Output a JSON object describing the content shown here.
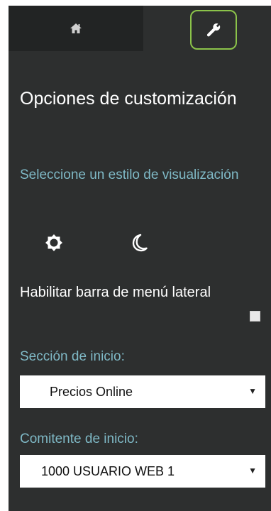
{
  "tabs": {
    "home_icon": "home-icon",
    "tools_icon": "wrench-icon",
    "active_border_color": "#8bc34a"
  },
  "panel": {
    "title": "Opciones de customización",
    "style_label": "Seleccione un estilo de visualización",
    "style_options": [
      "sun-icon",
      "moon-icon"
    ],
    "sidebar_label": "Habilitar barra de menú lateral",
    "sidebar_checked": false,
    "home_section_label": "Sección de inicio:",
    "home_section_value": "Precios Online",
    "home_account_label": "Comitente de inicio:",
    "home_account_value": "1000 USUARIO WEB 1",
    "dropdown_arrow": "▼"
  },
  "colors": {
    "panel_bg": "#2d2f2f",
    "tab_bg": "#222424",
    "accent_text": "#7fb9c6"
  }
}
